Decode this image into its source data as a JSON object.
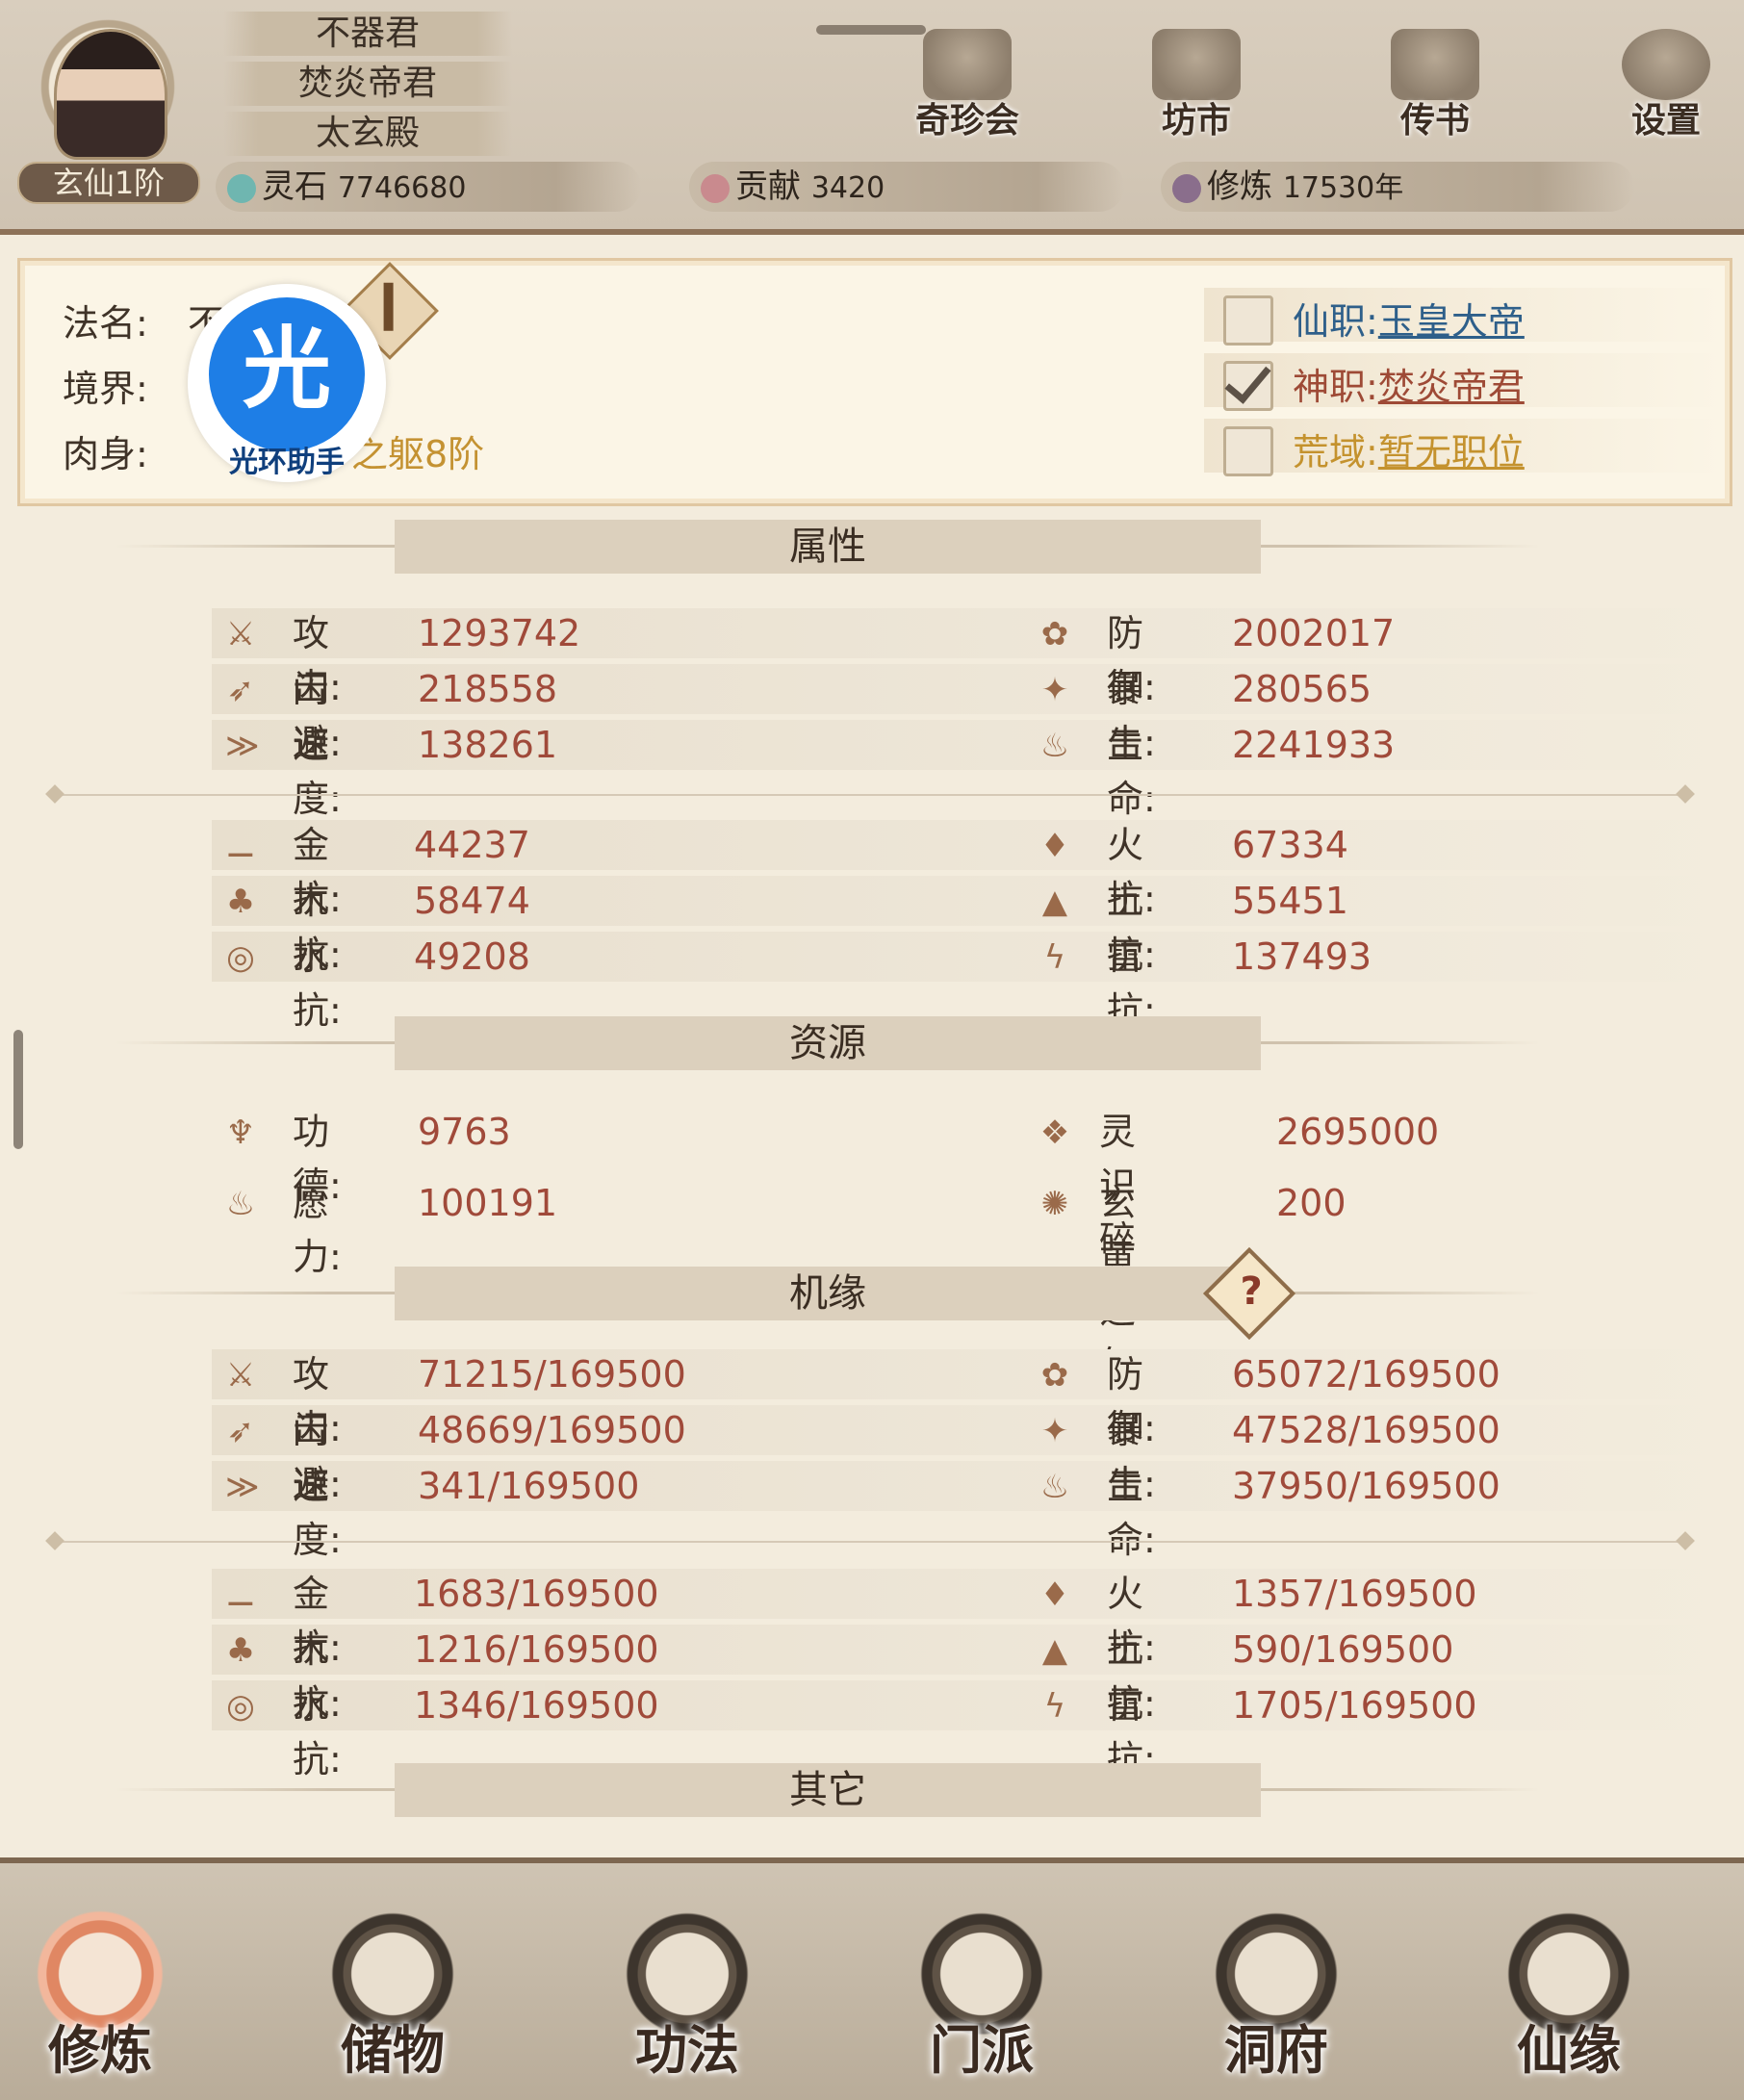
{
  "header": {
    "titles": [
      "不器君",
      "焚炎帝君",
      "太玄殿"
    ],
    "rank": "玄仙1阶",
    "nav": [
      {
        "label": "奇珍会",
        "icon": "pavilion-icon"
      },
      {
        "label": "坊市",
        "icon": "market-icon"
      },
      {
        "label": "传书",
        "icon": "scroll-icon"
      },
      {
        "label": "设置",
        "icon": "gear-icon"
      }
    ],
    "resources": [
      {
        "label": "灵石",
        "value": "7746680",
        "icon": "spirit-stone-icon"
      },
      {
        "label": "贡献",
        "value": "3420",
        "icon": "contribution-icon"
      },
      {
        "label": "修炼",
        "value": "17530年",
        "icon": "cultivation-icon"
      }
    ]
  },
  "profile": {
    "name_label": "法名:",
    "name_value": "不器",
    "realm_label": "境界:",
    "body_label": "肉身:",
    "body_value": "之躯8阶",
    "overlay_text": "光环助手",
    "overlay_char": "光",
    "jobs": [
      {
        "label": "仙职:",
        "value": "玉皇大帝",
        "checked": false,
        "color": "#2e5f8a"
      },
      {
        "label": "神职:",
        "value": "焚炎帝君",
        "checked": true,
        "color": "#9e4a36"
      },
      {
        "label": "荒域:",
        "value": "暂无职位",
        "checked": false,
        "color": "#c4922e"
      }
    ]
  },
  "sections": {
    "attributes": "属性",
    "resources": "资源",
    "fortune": "机缘",
    "other": "其它"
  },
  "attributes": {
    "primary": [
      {
        "label": "攻击:",
        "value": "1293742",
        "icon": "attack-icon"
      },
      {
        "label": "防御:",
        "value": "2002017",
        "icon": "defense-icon"
      },
      {
        "label": "闪避:",
        "value": "218558",
        "icon": "dodge-icon"
      },
      {
        "label": "暴击:",
        "value": "280565",
        "icon": "crit-icon"
      },
      {
        "label": "速度:",
        "value": "138261",
        "icon": "speed-icon"
      },
      {
        "label": "生命:",
        "value": "2241933",
        "icon": "life-icon"
      }
    ],
    "resist": [
      {
        "label": "金抗:",
        "value": "44237",
        "icon": "metal-icon"
      },
      {
        "label": "火抗:",
        "value": "67334",
        "icon": "fire-icon"
      },
      {
        "label": "木抗:",
        "value": "58474",
        "icon": "wood-icon"
      },
      {
        "label": "土抗:",
        "value": "55451",
        "icon": "earth-icon"
      },
      {
        "label": "水抗:",
        "value": "49208",
        "icon": "water-icon"
      },
      {
        "label": "雷抗:",
        "value": "137493",
        "icon": "thunder-icon"
      }
    ]
  },
  "resources": [
    {
      "label": "功德:",
      "value": "9763",
      "icon": "merit-icon"
    },
    {
      "label": "灵识碎片:",
      "value": "2695000",
      "icon": "soul-shard-icon"
    },
    {
      "label": "愿力:",
      "value": "100191",
      "icon": "wish-icon"
    },
    {
      "label": "玄黄之气:",
      "value": "200",
      "icon": "qi-icon"
    }
  ],
  "fortune": {
    "primary": [
      {
        "label": "攻击:",
        "value": "71215/169500",
        "icon": "attack-icon"
      },
      {
        "label": "防御:",
        "value": "65072/169500",
        "icon": "defense-icon"
      },
      {
        "label": "闪避:",
        "value": "48669/169500",
        "icon": "dodge-icon"
      },
      {
        "label": "暴击:",
        "value": "47528/169500",
        "icon": "crit-icon"
      },
      {
        "label": "速度:",
        "value": "341/169500",
        "icon": "speed-icon"
      },
      {
        "label": "生命:",
        "value": "37950/169500",
        "icon": "life-icon"
      }
    ],
    "resist": [
      {
        "label": "金抗:",
        "value": "1683/169500",
        "icon": "metal-icon"
      },
      {
        "label": "火抗:",
        "value": "1357/169500",
        "icon": "fire-icon"
      },
      {
        "label": "木抗:",
        "value": "1216/169500",
        "icon": "wood-icon"
      },
      {
        "label": "土抗:",
        "value": "590/169500",
        "icon": "earth-icon"
      },
      {
        "label": "水抗:",
        "value": "1346/169500",
        "icon": "water-icon"
      },
      {
        "label": "雷抗:",
        "value": "1705/169500",
        "icon": "thunder-icon"
      }
    ],
    "help": "?"
  },
  "tabs": [
    {
      "label": "修炼",
      "active": true
    },
    {
      "label": "储物",
      "active": false
    },
    {
      "label": "功法",
      "active": false
    },
    {
      "label": "门派",
      "active": false
    },
    {
      "label": "洞府",
      "active": false
    },
    {
      "label": "仙缘",
      "active": false
    }
  ]
}
